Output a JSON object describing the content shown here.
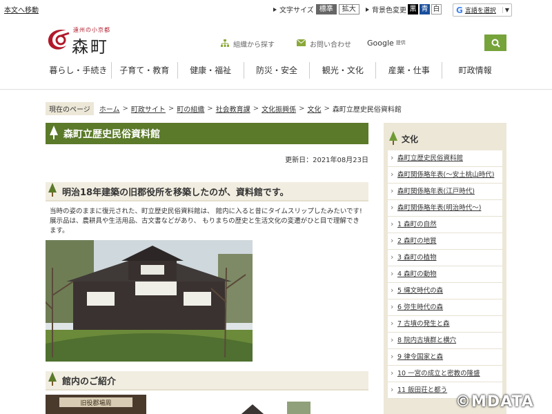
{
  "topbar": {
    "skip_link": "本文へ移動",
    "font_size_label": "文字サイズ",
    "font_size_options": [
      "標準",
      "拡大"
    ],
    "bg_color_label": "背景色変更",
    "bg_color_options": [
      "黒",
      "青",
      "白"
    ],
    "translate_label": "言語を選択",
    "translate_arrow": "▼"
  },
  "header": {
    "logo_sub": "遠州の小京都",
    "logo_main": "森町",
    "link_org": "組織から探す",
    "link_contact": "お問い合わせ",
    "search_brand": "Google",
    "search_brand_suffix": "提供"
  },
  "nav": [
    "暮らし・手続き",
    "子育て・教育",
    "健康・福祉",
    "防災・安全",
    "観光・文化",
    "産業・仕事",
    "町政情報"
  ],
  "breadcrumb": {
    "current_label": "現在のページ",
    "items": [
      "ホーム",
      "町政サイト",
      "町の組織",
      "社会教育課",
      "文化振興係",
      "文化"
    ],
    "current": "森町立歴史民俗資料館"
  },
  "page": {
    "title": "森町立歴史民俗資料館",
    "updated": "更新日：2021年08月23日",
    "section1_title": "明治18年建築の旧郡役所を移築したのが、資料館です。",
    "section1_text": "当時の姿のままに復元された、町立歴史民俗資料館は、 館内に入ると昔にタイムスリップしたみたいです! 展示品は、農耕具や生活用品、古文書などがあり、 もりまちの歴史と生活文化の変遷がひと目で理解できます。",
    "section2_title": "館内のご紹介",
    "thumb_sign": "旧役郡場周"
  },
  "sidebar": {
    "title": "文化",
    "items": [
      "森町立歴史民俗資料館",
      "森町関係略年表(～安土桃山時代)",
      "森町関係略年表(江戸時代)",
      "森町関係略年表(明治時代～)",
      "1 森町の自然",
      "2 森町の地質",
      "3 森町の植物",
      "4 森町の動物",
      "5 縄文時代の森",
      "6 弥生時代の森",
      "7 古墳の発生と森",
      "8 院内古墳群と横穴",
      "9 律令国家と森",
      "10 一宮の成立と密教の隆盛",
      "11 飯田荘と都う"
    ]
  },
  "watermark": "©MDATA",
  "colors": {
    "green": "#5b7a2a",
    "accent": "#76a33a",
    "beige": "#ece7d7"
  }
}
